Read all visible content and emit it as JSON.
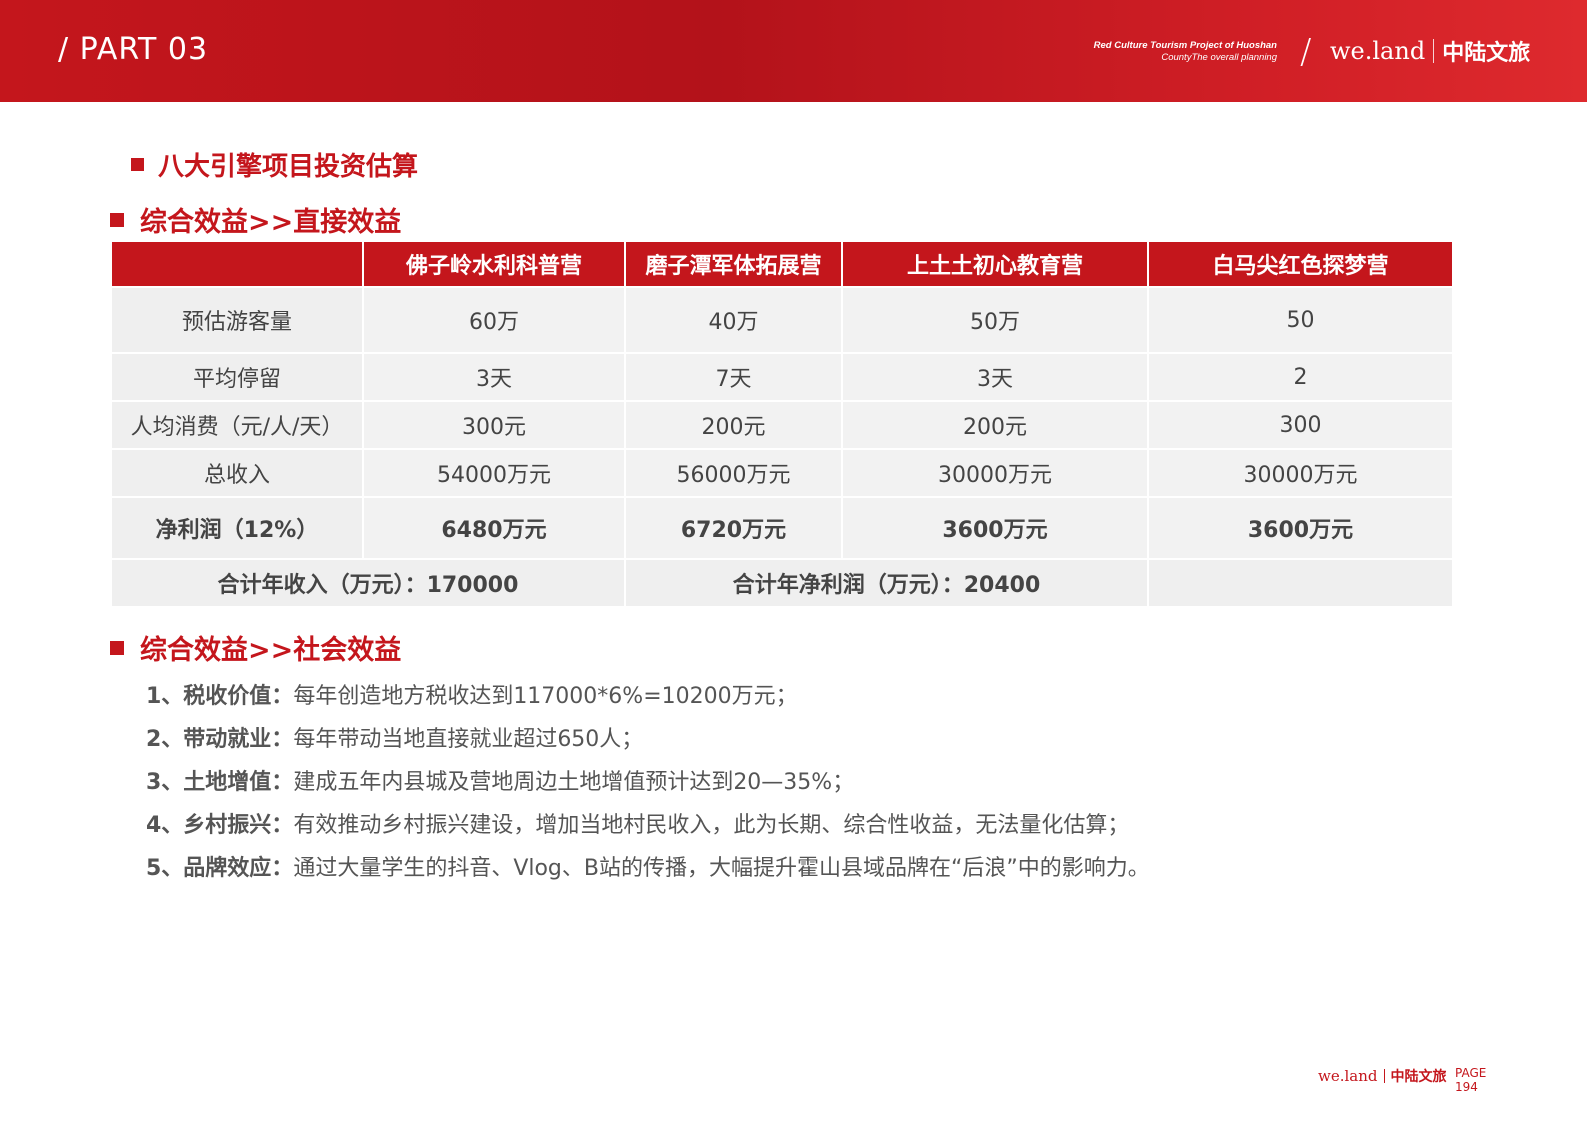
{
  "header": {
    "part": "/ PART 03",
    "project_line1": "Red Culture Tourism Project of Huoshan",
    "project_line2": "CountyThe overall planning",
    "slash": "/",
    "logo_en": "we.land",
    "logo_cn": "中陆文旅"
  },
  "headings": {
    "main": "八大引擎项目投资估算",
    "direct": "综合效益>>直接效益",
    "social": "综合效益>>社会效益"
  },
  "table": {
    "columns": [
      "",
      "佛子岭水利科普营",
      "磨子潭军体拓展营",
      "上土土初心教育营",
      "白马尖红色探梦营"
    ],
    "rows": [
      {
        "label": "预估游客量",
        "values": [
          "60万",
          "40万",
          "50万",
          "50"
        ]
      },
      {
        "label": "平均停留",
        "values": [
          "3天",
          "7天",
          "3天",
          "2"
        ]
      },
      {
        "label": "人均消费（元/人/天）",
        "values": [
          "300元",
          "200元",
          "200元",
          "300"
        ]
      },
      {
        "label": "总收入",
        "values": [
          "54000万元",
          "56000万元",
          "30000万元",
          "30000万元"
        ]
      },
      {
        "label": "净利润（12%）",
        "values": [
          "6480万元",
          "6720万元",
          "3600万元",
          "3600万元"
        ]
      }
    ],
    "total_income": "合计年收入（万元）：170000",
    "total_profit": "合计年净利润（万元）：20400"
  },
  "social": [
    {
      "key": "1、税收价值：",
      "text": "每年创造地方税收达到117000*6%=10200万元；"
    },
    {
      "key": "2、带动就业：",
      "text": "每年带动当地直接就业超过650人；"
    },
    {
      "key": "3、土地增值：",
      "text": "建成五年内县城及营地周边土地增值预计达到20—35%；"
    },
    {
      "key": "4、乡村振兴：",
      "text": "有效推动乡村振兴建设，增加当地村民收入，此为长期、综合性收益，无法量化估算；"
    },
    {
      "key": "5、品牌效应：",
      "text": "通过大量学生的抖音、Vlog、B站的传播，大幅提升霍山县域品牌在“后浪”中的影响力。"
    }
  ],
  "footer": {
    "logo_en": "we.land",
    "logo_cn": "中陆文旅",
    "page_label": "PAGE",
    "page_number": "194"
  },
  "colors": {
    "brand_red": "#c4161c",
    "table_cell": "#f2f2f2"
  }
}
